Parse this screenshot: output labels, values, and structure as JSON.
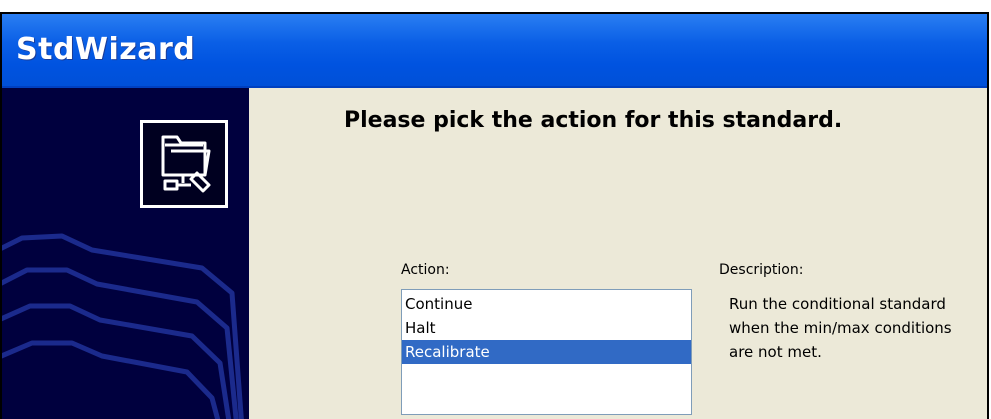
{
  "window": {
    "title": "StdWizard"
  },
  "sidebar": {
    "icon": "network-folder-icon"
  },
  "main": {
    "heading": "Please pick the action for this standard.",
    "action_label": "Action:",
    "description_label": "Description:",
    "actions": [
      {
        "label": "Continue",
        "selected": false
      },
      {
        "label": "Halt",
        "selected": false
      },
      {
        "label": "Recalibrate",
        "selected": true
      }
    ],
    "description_lines": [
      "Run the conditional standard",
      "when the min/max conditions",
      "are not met."
    ]
  },
  "colors": {
    "title_bar": "#0053e0",
    "sidebar_bg": "#00003e",
    "dialog_bg": "#ece9d8",
    "selection": "#316ac5"
  }
}
